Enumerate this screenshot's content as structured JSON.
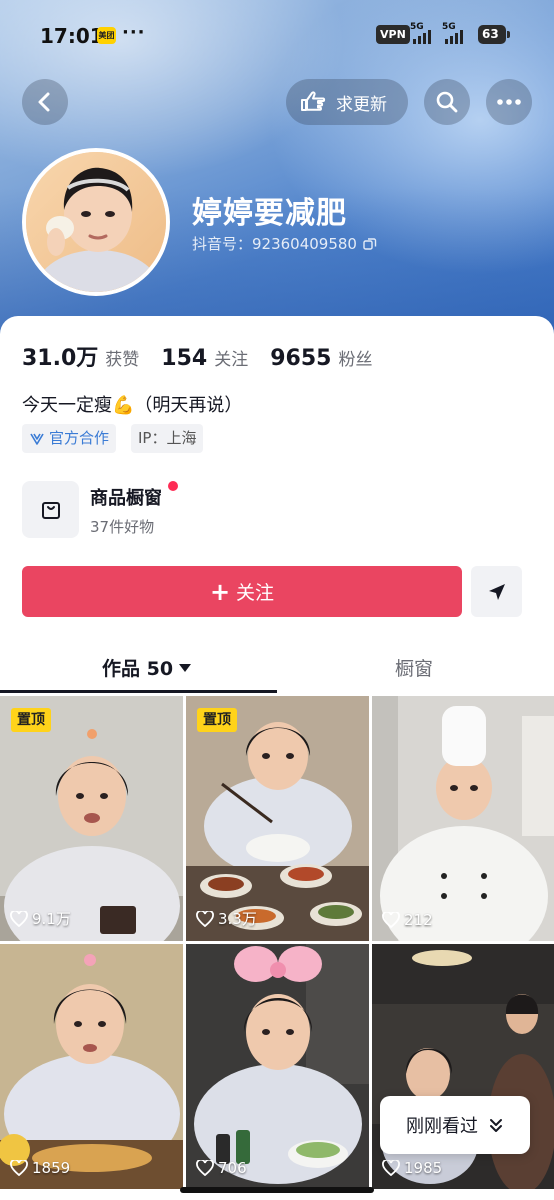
{
  "status_bar": {
    "time": "17:01",
    "app_badge": "美团",
    "dots": "···",
    "vpn": "VPN",
    "signal_1": "5G",
    "signal_2": "5G",
    "battery": "63"
  },
  "nav": {
    "back_icon": "chevron-left-icon",
    "request_update_label": "求更新",
    "search_icon": "search-icon",
    "more_icon": "more-icon"
  },
  "profile": {
    "nickname": "婷婷要减肥",
    "douyin_id": "抖音号：92360409580"
  },
  "stats": [
    {
      "num": "31.0万",
      "label": "获赞"
    },
    {
      "num": "154",
      "label": "关注"
    },
    {
      "num": "9655",
      "label": "粉丝"
    }
  ],
  "bio": "今天一定瘦💪（明天再说）",
  "tags": {
    "official": "官方合作",
    "ip": "IP：上海"
  },
  "shop": {
    "title": "商品橱窗",
    "subtitle": "37件好物"
  },
  "actions": {
    "follow": "关注",
    "follow_plus": "+"
  },
  "tabs": {
    "works": "作品 50",
    "shop": "橱窗"
  },
  "videos": [
    {
      "pinned": "置顶",
      "likes": "9.1万"
    },
    {
      "pinned": "置顶",
      "likes": "3.3万"
    },
    {
      "pinned": "",
      "likes": "212"
    },
    {
      "pinned": "",
      "likes": "1859"
    },
    {
      "pinned": "",
      "likes": "706"
    },
    {
      "pinned": "",
      "likes": "1985"
    }
  ],
  "recent_label": "刚刚看过",
  "colors": {
    "accent_red": "#ea4561",
    "pin_yellow": "#ffd31a",
    "official_blue": "#3a7bd5"
  }
}
